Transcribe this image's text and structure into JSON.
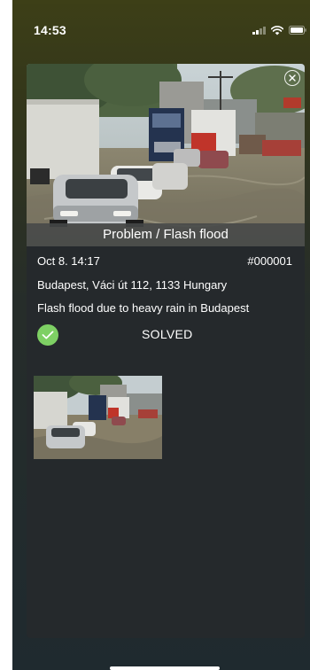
{
  "status_bar": {
    "time": "14:53"
  },
  "report": {
    "caption": "Problem / Flash flood",
    "date": "Oct 8. 14:17",
    "ticket_id": "#000001",
    "address": "Budapest, Váci út 112, 1133 Hungary",
    "description": "Flash flood due to heavy rain in Budapest",
    "status": "SOLVED",
    "status_color": "#7ed064"
  },
  "icons": {
    "close": "close-circle-icon",
    "status": "check-circle-icon"
  },
  "colors": {
    "card_background": "#25292c",
    "screen_background_top": "#3d3f17"
  }
}
